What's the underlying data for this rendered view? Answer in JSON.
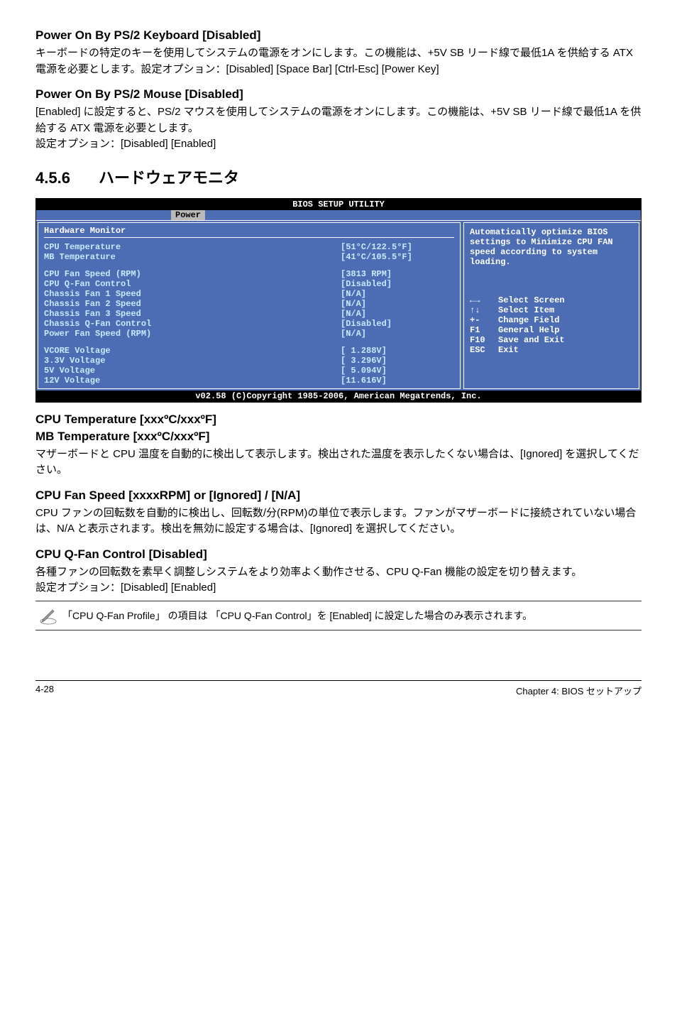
{
  "s1": {
    "title": "Power On By PS/2 Keyboard [Disabled]",
    "body": "キーボードの特定のキーを使用してシステムの電源をオンにします。この機能は、+5V SB リード線で最低1A を供給する ATX 電源を必要とします。設定オプション：[Disabled] [Space Bar] [Ctrl-Esc] [Power Key]"
  },
  "s2": {
    "title": "Power On By PS/2 Mouse [Disabled]",
    "body": "[Enabled] に設定すると、PS/2 マウスを使用してシステムの電源をオンにします。この機能は、+5V SB リード線で最低1A を供給する ATX 電源を必要とします。\n設定オプション：[Disabled] [Enabled]"
  },
  "h456": {
    "num": "4.5.6",
    "title": "ハードウェアモニタ"
  },
  "bios": {
    "topbar": "BIOS SETUP UTILITY",
    "tab": "Power",
    "panel_title": "Hardware Monitor",
    "rows1": [
      {
        "label": "CPU Temperature",
        "value": "[51°C/122.5°F]"
      },
      {
        "label": "MB Temperature",
        "value": "[41°C/105.5°F]"
      }
    ],
    "rows2": [
      {
        "label": "CPU Fan Speed (RPM)",
        "value": "[3813 RPM]"
      },
      {
        "label": "CPU Q-Fan Control",
        "value": "[Disabled]"
      },
      {
        "label": "Chassis Fan 1 Speed",
        "value": "[N/A]"
      },
      {
        "label": "Chassis Fan 2 Speed",
        "value": "[N/A]"
      },
      {
        "label": "Chassis Fan 3 Speed",
        "value": "[N/A]"
      },
      {
        "label": "Chassis Q-Fan Control",
        "value": "[Disabled]"
      },
      {
        "label": "Power Fan Speed (RPM)",
        "value": "[N/A]"
      }
    ],
    "rows3": [
      {
        "label": "VCORE Voltage",
        "value": "[ 1.288V]"
      },
      {
        "label": "3.3V Voltage",
        "value": "[ 3.296V]"
      },
      {
        "label": "5V Voltage",
        "value": "[ 5.094V]"
      },
      {
        "label": "12V Voltage",
        "value": "[11.616V]"
      }
    ],
    "right_text": "Automatically optimize BIOS settings to Minimize CPU FAN speed according to system loading.",
    "keys": [
      {
        "k": "←→",
        "t": "Select Screen"
      },
      {
        "k": "↑↓",
        "t": "Select Item"
      },
      {
        "k": "+-",
        "t": "Change Field"
      },
      {
        "k": "F1",
        "t": "General Help"
      },
      {
        "k": "F10",
        "t": "Save and Exit"
      },
      {
        "k": "ESC",
        "t": "Exit"
      }
    ],
    "footer": "v02.58 (C)Copyright 1985-2006, American Megatrends, Inc."
  },
  "s3": {
    "title1": "CPU Temperature [xxxºC/xxxºF]",
    "title2": "MB Temperature [xxxºC/xxxºF]",
    "body": "マザーボードと CPU 温度を自動的に検出して表示します。検出された温度を表示したくない場合は、[Ignored] を選択してください。"
  },
  "s4": {
    "title": "CPU Fan Speed [xxxxRPM] or [Ignored] / [N/A]",
    "body": "CPU ファンの回転数を自動的に検出し、回転数/分(RPM)の単位で表示します。ファンがマザーボードに接続されていない場合は、N/A と表示されます。検出を無効に設定する場合は、[Ignored] を選択してください。"
  },
  "s5": {
    "title": "CPU Q-Fan Control [Disabled]",
    "body": "各種ファンの回転数を素早く調整しシステムをより効率よく動作させる、CPU Q-Fan 機能の設定を切り替えます。\n設定オプション：[Disabled] [Enabled]"
  },
  "note": "「CPU Q-Fan Profile」 の項目は 「CPU Q-Fan Control」を [Enabled] に設定した場合のみ表示されます。",
  "footer": {
    "left": "4-28",
    "right": "Chapter 4: BIOS セットアップ"
  }
}
